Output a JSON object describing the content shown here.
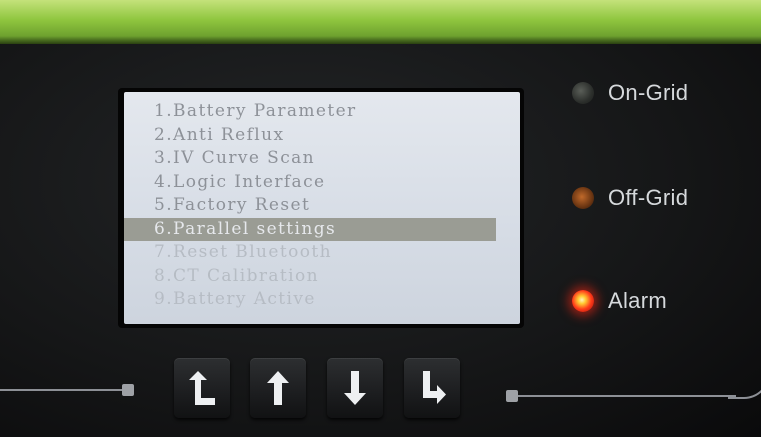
{
  "lcd_menu": {
    "items": [
      {
        "label": "1.Battery Parameter",
        "selected": false
      },
      {
        "label": "2.Anti Reflux",
        "selected": false
      },
      {
        "label": "3.IV Curve Scan",
        "selected": false
      },
      {
        "label": "4.Logic Interface",
        "selected": false
      },
      {
        "label": "5.Factory Reset",
        "selected": false
      },
      {
        "label": "6.Parallel settings",
        "selected": true
      },
      {
        "label": "7.Reset Bluetooth",
        "selected": false
      },
      {
        "label": "8.CT Calibration",
        "selected": false
      },
      {
        "label": "9.Battery Active",
        "selected": false
      }
    ]
  },
  "indicators": {
    "on_grid": {
      "label": "On-Grid",
      "state": "off"
    },
    "off_grid": {
      "label": "Off-Grid",
      "state": "off"
    },
    "alarm": {
      "label": "Alarm",
      "state": "on",
      "color": "#ff2a14"
    }
  },
  "keypad": {
    "keys": [
      {
        "icon": "return-up-left-icon"
      },
      {
        "icon": "arrow-up-icon"
      },
      {
        "icon": "arrow-down-icon"
      },
      {
        "icon": "enter-down-right-icon"
      }
    ]
  },
  "colors": {
    "housing_green": "#8fc63f",
    "lcd_background": "#d9dfe7",
    "lcd_text": "#8d9198",
    "selection_bar": "#9a9c94"
  }
}
